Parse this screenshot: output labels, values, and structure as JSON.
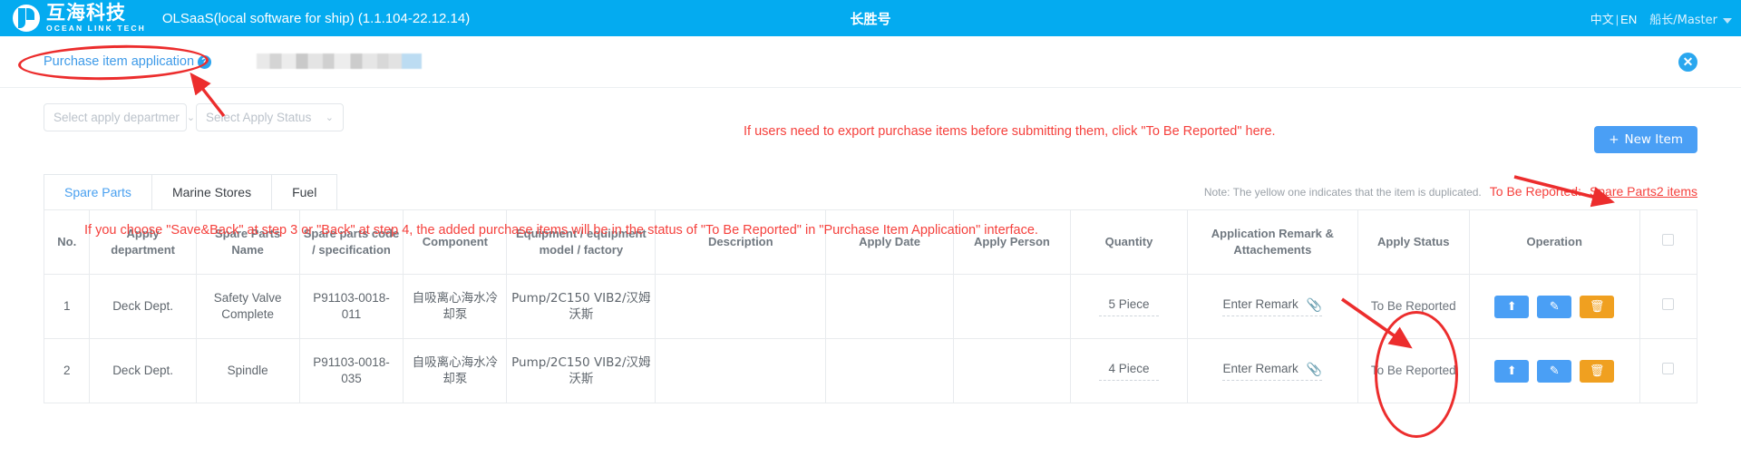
{
  "header": {
    "logo_cn": "互海科技",
    "logo_en": "OCEAN LINK TECH",
    "app_title": "OLSaaS(local software for ship)  (1.1.104-22.12.14)",
    "vessel": "长胜号",
    "lang_cn": "中文",
    "lang_sep": "|",
    "lang_en": "EN",
    "user": "船长/Master"
  },
  "breadcrumb": {
    "title": "Purchase item application",
    "help_icon": "?",
    "close_icon": "✕"
  },
  "filters": {
    "department": "Select apply departmer",
    "status": "Select Apply Status",
    "chevron": "⌄",
    "new_item": "New Item",
    "new_item_plus": "+"
  },
  "annotations": {
    "export_hint": "If users need to export purchase items before submitting them, click \"To Be Reported\" here.",
    "steps_hint": "If you choose \"Save&Back\" at step 3 or \"Back\" at step 4, the added purchase items will be in the status of \"To Be Reported\" in \"Purchase Item Application\" interface."
  },
  "tabs": [
    {
      "label": "Spare Parts",
      "active": true
    },
    {
      "label": "Marine Stores",
      "active": false
    },
    {
      "label": "Fuel",
      "active": false
    }
  ],
  "note": {
    "gray": "Note: The yellow one indicates that the item is duplicated.",
    "red_label": "To Be Reported:",
    "link": "Spare Parts2 items"
  },
  "table": {
    "columns": [
      "No.",
      "Apply department",
      "Spare Parts Name",
      "Spare parts code / specification",
      "Component",
      "Equipment / equipment model / factory",
      "Description",
      "Apply Date",
      "Apply Person",
      "Quantity",
      "Application Remark & Attachements",
      "Apply Status",
      "Operation"
    ],
    "rows": [
      {
        "no": "1",
        "department": "Deck Dept.",
        "name": "Safety Valve Complete",
        "code": "P91103-0018-011",
        "component": "自吸离心海水冷却泵",
        "equipment": "Pump/2C150 VIB2/汉姆沃斯",
        "description": "",
        "apply_date": "",
        "apply_person": "",
        "quantity": "5 Piece",
        "remark": "Enter Remark",
        "status": "To Be Reported"
      },
      {
        "no": "2",
        "department": "Deck Dept.",
        "name": "Spindle",
        "code": "P91103-0018-035",
        "component": "自吸离心海水冷却泵",
        "equipment": "Pump/2C150 VIB2/汉姆沃斯",
        "description": "",
        "apply_date": "",
        "apply_person": "",
        "quantity": "4 Piece",
        "remark": "Enter Remark",
        "status": "To Be Reported"
      }
    ],
    "ops": {
      "upload": "⬆",
      "edit": "✎",
      "delete": "🗑"
    },
    "clip_icon": "📎"
  },
  "colors": {
    "brand_blue": "#04abf0",
    "link_blue": "#3d9ae8",
    "button_blue": "#4a9ff5",
    "annotation_red": "#f5403c",
    "warn_orange": "#f0a020"
  }
}
